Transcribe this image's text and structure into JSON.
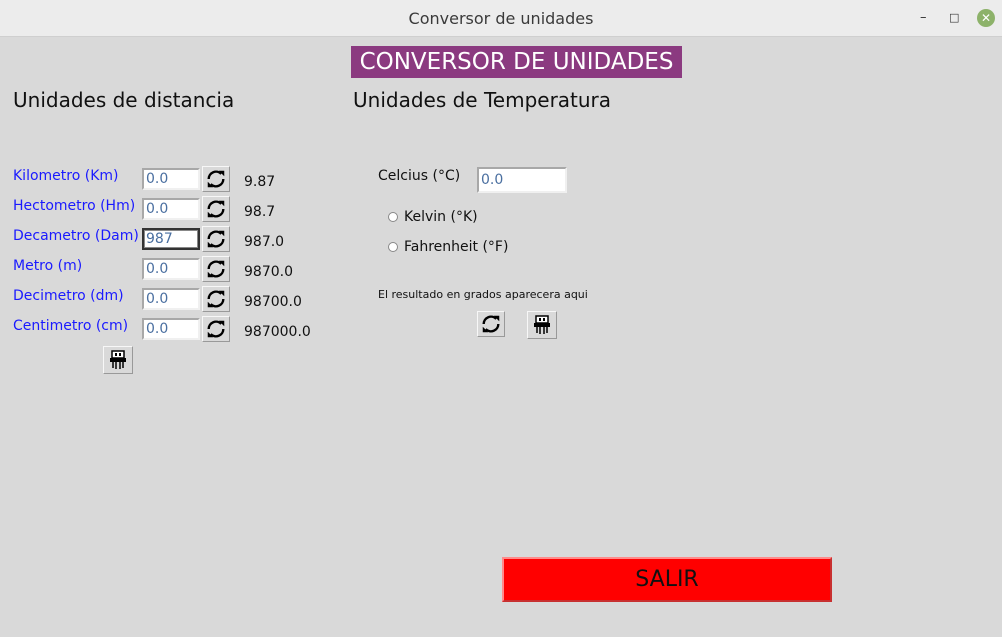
{
  "window": {
    "title": "Conversor de unidades",
    "controls": {
      "minimize": "–",
      "maximize": "□",
      "close": "✕"
    }
  },
  "header": {
    "title": "CONVERSOR DE UNIDADES"
  },
  "distance": {
    "title": "Unidades de distancia",
    "rows": [
      {
        "label": "Kilometro (Km)",
        "value": "0.0",
        "result": "9.87"
      },
      {
        "label": "Hectometro (Hm)",
        "value": "0.0",
        "result": "98.7"
      },
      {
        "label": "Decametro (Dam)",
        "value": "987",
        "result": "987.0"
      },
      {
        "label": "Metro (m)",
        "value": "0.0",
        "result": "9870.0"
      },
      {
        "label": "Decimetro (dm)",
        "value": "0.0",
        "result": "98700.0"
      },
      {
        "label": "Centimetro (cm)",
        "value": "0.0",
        "result": "987000.0"
      }
    ]
  },
  "temperature": {
    "title": "Unidades de Temperatura",
    "celcius_label": "Celcius (°C)",
    "celcius_value": "0.0",
    "options": [
      {
        "label": "Kelvin (°K)"
      },
      {
        "label": "Fahrenheit (°F)"
      }
    ],
    "result_text": "El resultado en grados aparecera aqui"
  },
  "icons": {
    "refresh": "refresh-icon",
    "clear": "broom-icon"
  },
  "footer": {
    "exit_label": "SALIR"
  },
  "colors": {
    "header_bg": "#8b3a80",
    "unit_label": "#1a1aff",
    "exit_bg": "#ff0000"
  }
}
